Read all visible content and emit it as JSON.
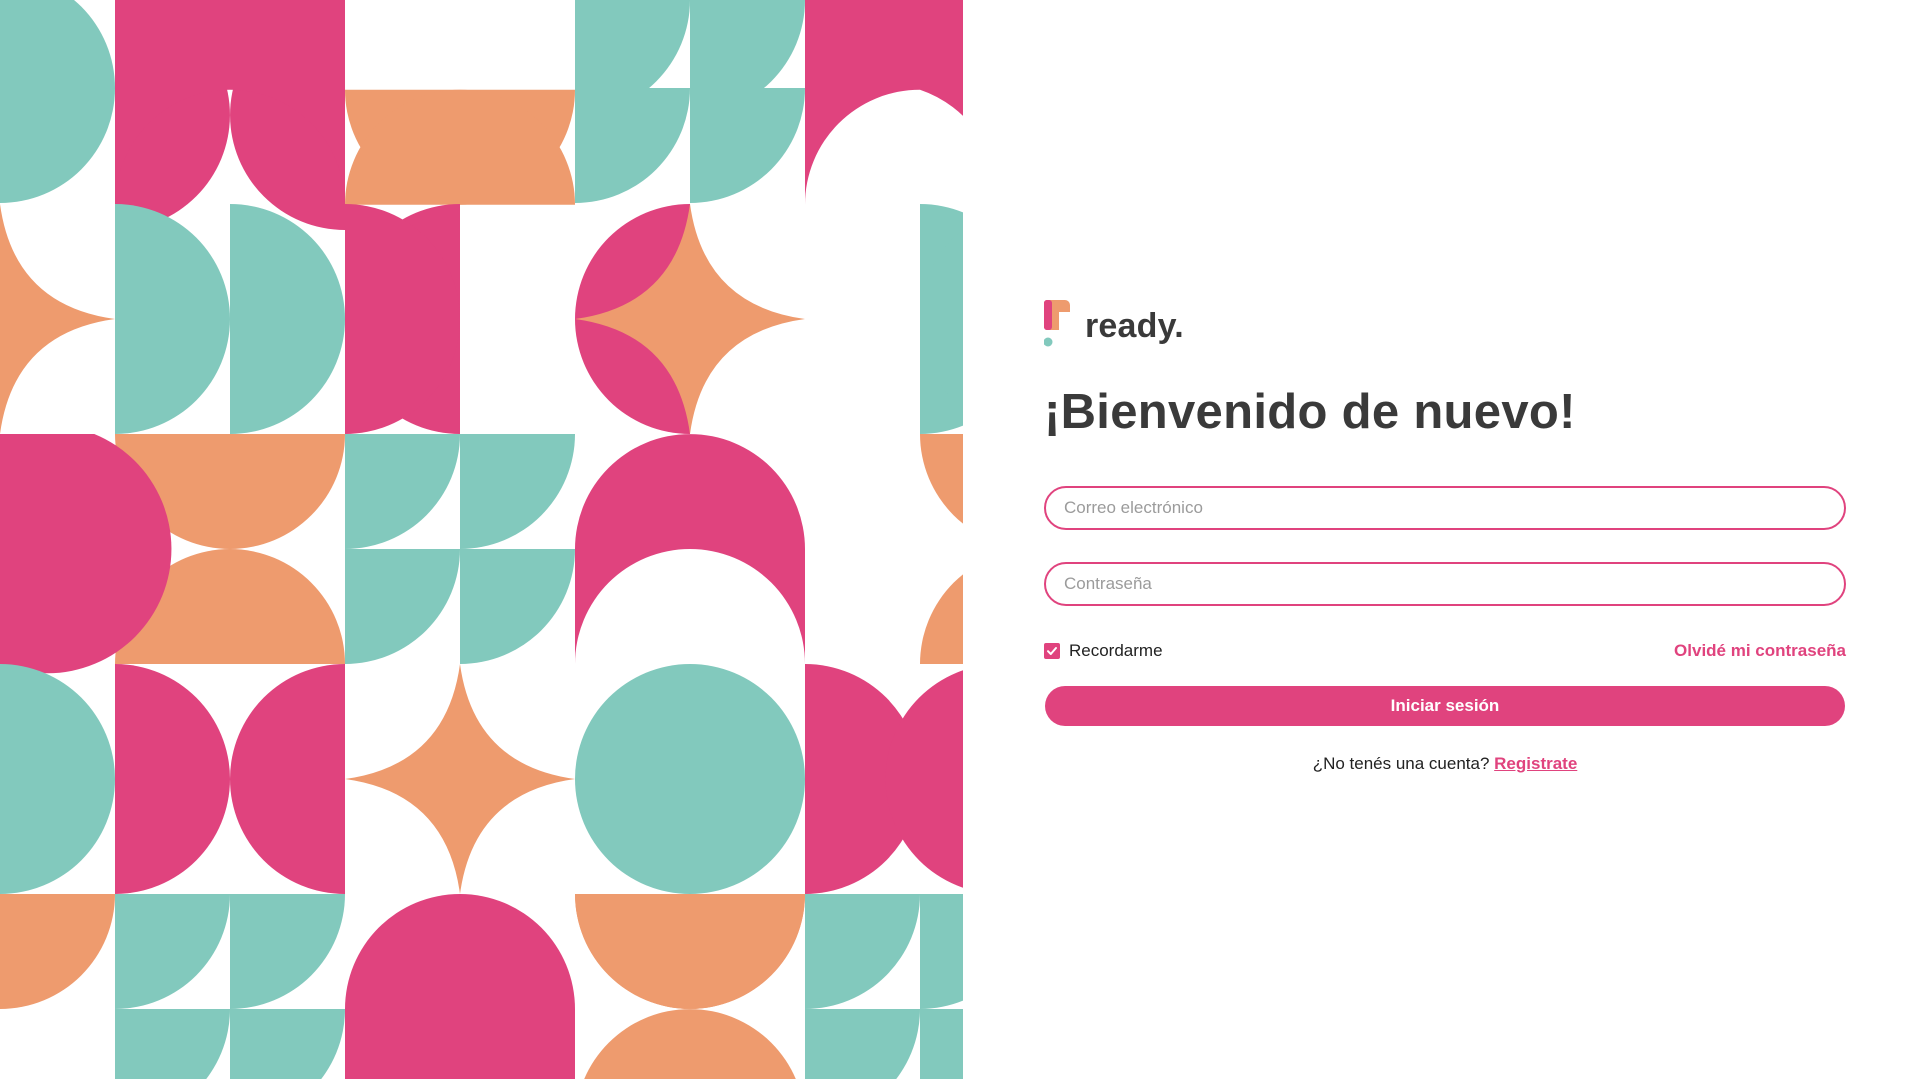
{
  "colors": {
    "brand_pink": "#e0437e",
    "teal": "#82c9bd",
    "orange": "#ee9b6e",
    "text_dark": "#3a3a3a"
  },
  "brand": {
    "logo_icon": "ready-logo-icon",
    "name": "ready."
  },
  "login": {
    "heading": "¡Bienvenido de nuevo!",
    "email_placeholder": "Correo electrónico",
    "email_value": "",
    "password_placeholder": "Contraseña",
    "password_value": "",
    "remember_label": "Recordarme",
    "remember_checked": true,
    "forgot_label": "Olvidé mi contraseña",
    "submit_label": "Iniciar sesión",
    "signup_prompt": "¿No tenés una cuenta?",
    "signup_link": "Registrate"
  }
}
